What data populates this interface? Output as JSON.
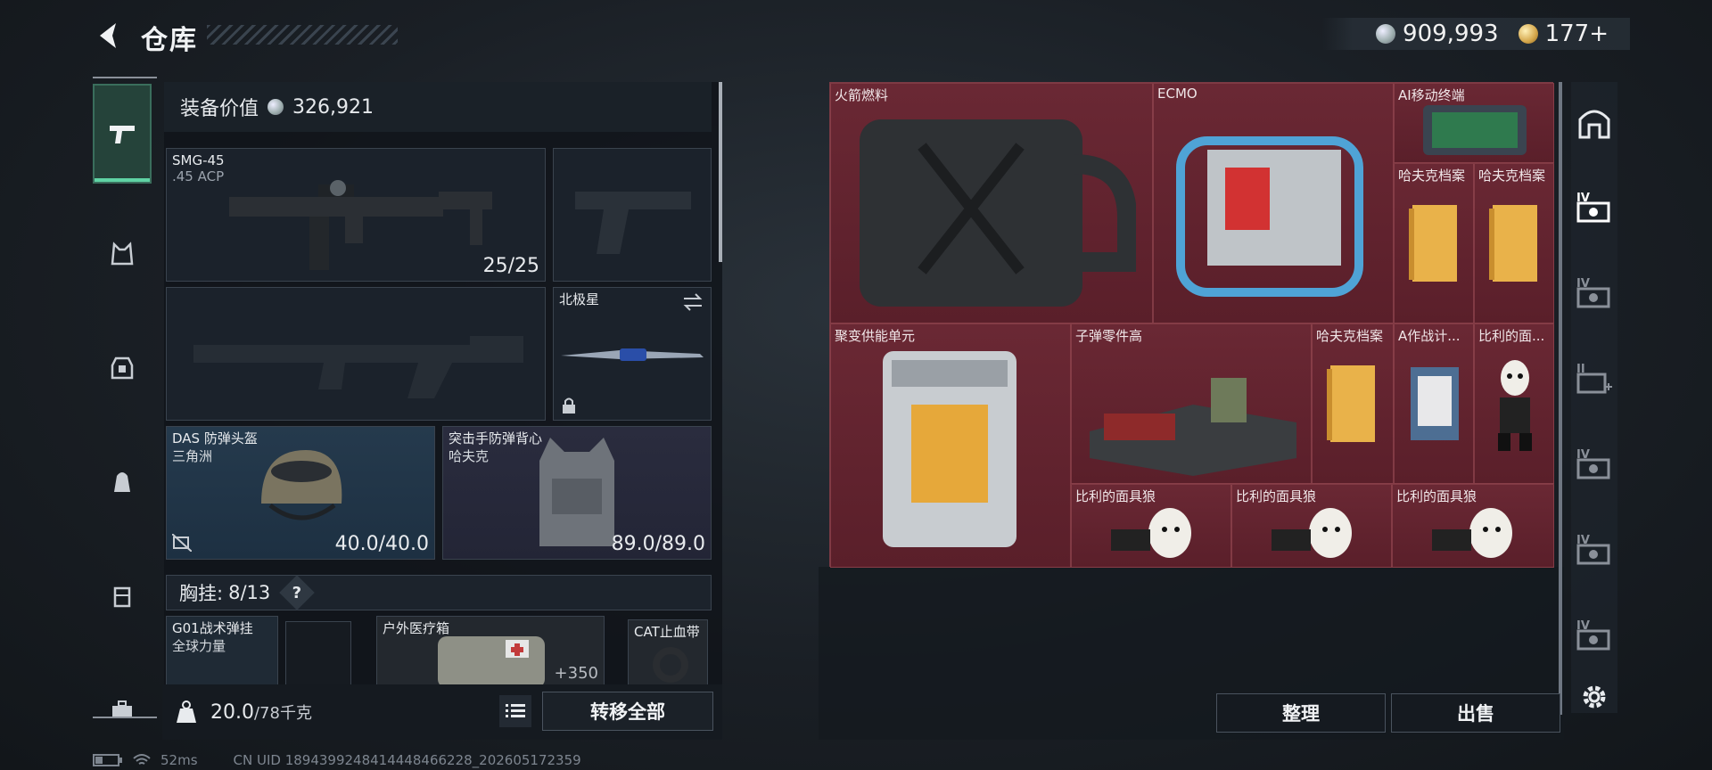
{
  "header": {
    "title": "仓库",
    "currency_silver": "909,993",
    "currency_gold": "177+"
  },
  "equipment": {
    "value_label": "装备价值",
    "value": "326,921",
    "primary": {
      "name": "SMG-45",
      "caliber": ".45 ACP",
      "ammo": "25/25"
    },
    "melee": {
      "name": "北极星"
    },
    "helmet": {
      "name": "DAS 防弹头盔",
      "faction": "三角洲",
      "durability": "40.0/40.0"
    },
    "armor": {
      "name": "突击手防弹背心",
      "faction": "哈夫克",
      "durability": "89.0/89.0"
    },
    "vest": {
      "label": "胸挂:",
      "capacity": "8/13",
      "help": "?"
    },
    "vest_items": [
      {
        "name": "G01战术弹挂",
        "sub": "全球力量"
      },
      {
        "name": "户外医疗箱",
        "extra": "+350"
      },
      {
        "name": "CAT止血带"
      }
    ],
    "weight": "20.0",
    "weight_max": "/78千克",
    "transfer_all": "转移全部"
  },
  "stash": {
    "items": [
      {
        "label": "火箭燃料"
      },
      {
        "label": "ECMO"
      },
      {
        "label": "AI移动终端"
      },
      {
        "label": "哈夫克档案"
      },
      {
        "label": "哈夫克档案"
      },
      {
        "label": "聚变供能单元"
      },
      {
        "label": "子弹零件高"
      },
      {
        "label": "哈夫克档案"
      },
      {
        "label": "A作战计..."
      },
      {
        "label": "比利的面..."
      },
      {
        "label": "比利的面具狼"
      },
      {
        "label": "比利的面具狼"
      },
      {
        "label": "比利的面具狼"
      }
    ],
    "sort_label": "整理",
    "sell_label": "出售"
  },
  "rail": {
    "tier_labels": [
      "IV",
      "IV",
      "II",
      "IV",
      "IV",
      "IV"
    ]
  },
  "status": {
    "ping": "52ms",
    "uid": "CN UID 1894399248414448466228_202605172359"
  },
  "colors": {
    "stash_bg": "#581c28",
    "active_tab": "#5fd3a4"
  }
}
